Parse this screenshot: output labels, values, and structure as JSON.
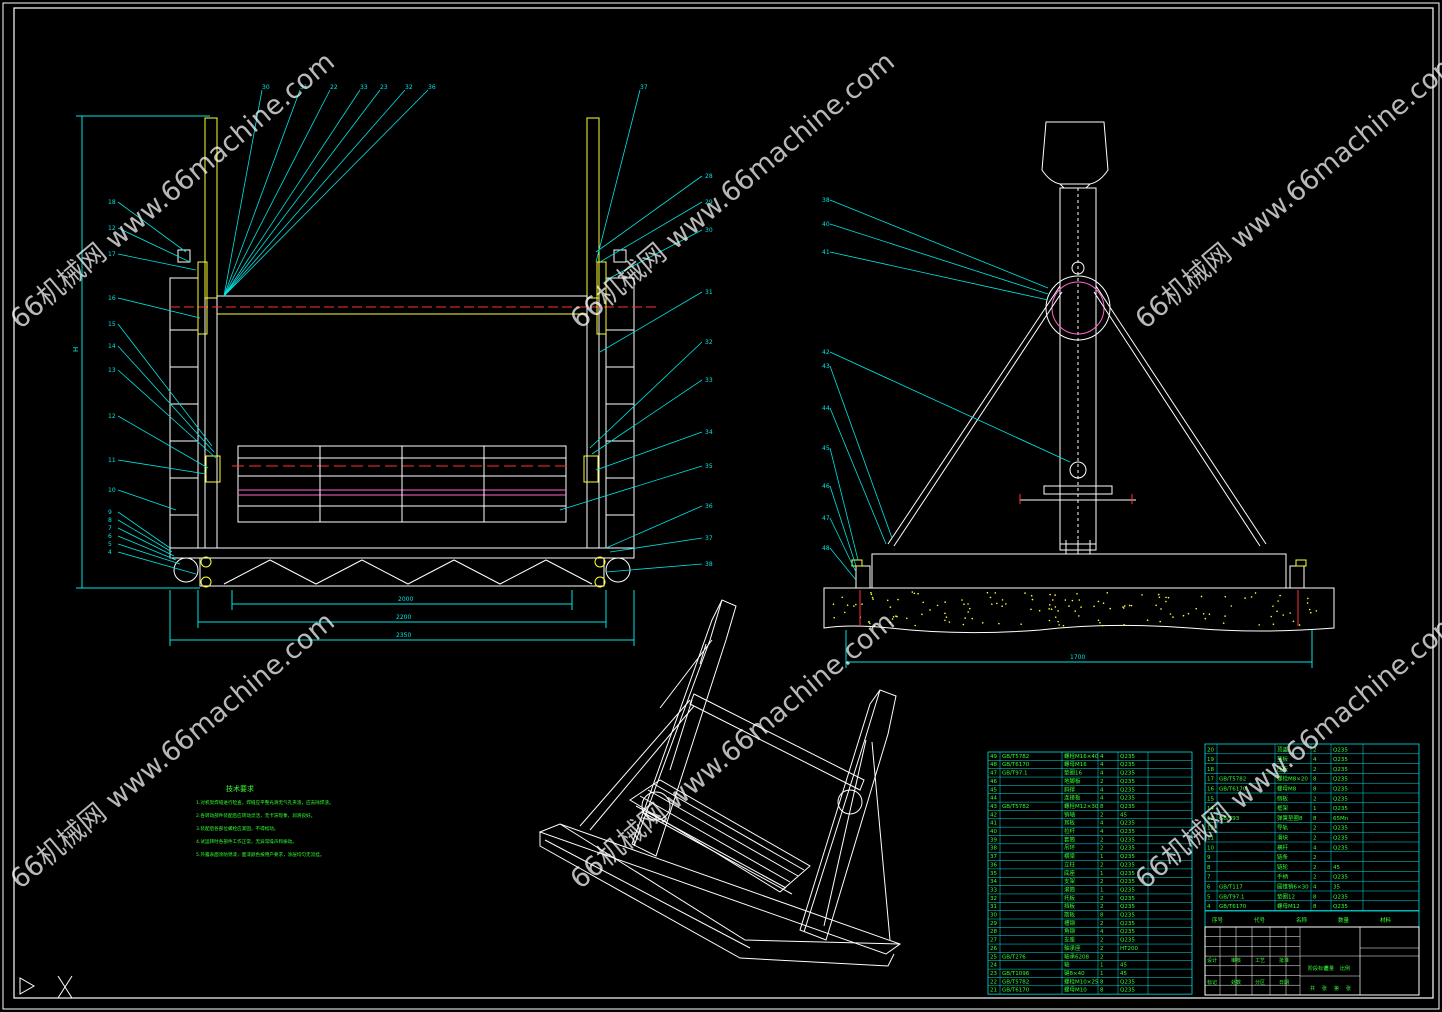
{
  "watermark": {
    "text": "66机械网 www.66machine.com",
    "color": "#ffffff"
  },
  "colors": {
    "background": "#000000",
    "frame": "#ffffff",
    "leader": "#00e5e5",
    "yellow": "#ffff33",
    "green": "#33ff33",
    "red": "#ff3333",
    "magenta": "#ff66cc",
    "table": "#00e5e5"
  },
  "front_view": {
    "balloons_top": [
      "30",
      "31",
      "22",
      "33",
      "23",
      "32",
      "36",
      "37"
    ],
    "balloons_left": [
      "18",
      "12",
      "17",
      "16",
      "15",
      "14",
      "13",
      "12",
      "11",
      "10",
      "9",
      "8",
      "7",
      "6",
      "5",
      "4"
    ],
    "balloons_right": [
      "28",
      "29",
      "30",
      "31",
      "32",
      "33",
      "34",
      "35",
      "36",
      "37",
      "38"
    ],
    "dim_height": "H",
    "dim_inner": "2000",
    "dim_mid": "2200",
    "dim_total": "2350"
  },
  "side_view": {
    "balloons": [
      "38",
      "40",
      "41",
      "42",
      "43",
      "44",
      "45",
      "46",
      "47",
      "48"
    ],
    "dim_base": "1700"
  },
  "tech_notes": {
    "title": "技术要求",
    "lines": [
      "1.对机架焊缝进行检查，焊缝应平整光滑无气孔夹渣，应去除焊渣。",
      "2.各转动部件装配后应转动灵活，无卡滞现象，润滑良好。",
      "3.装配后各部位螺栓应紧固，不得松动。",
      "4.试运转时各部件工作正常，无异常噪声和振动。",
      "5.外露表面涂防锈漆，面漆颜色按用户要求，涂层均匀无流挂。"
    ]
  },
  "bom": {
    "rows_left": [
      [
        "49",
        "GB/T5782",
        "螺栓M16×40",
        "4",
        "Q235"
      ],
      [
        "48",
        "GB/T6170",
        "螺母M16",
        "4",
        "Q235"
      ],
      [
        "47",
        "GB/T97.1",
        "垫圈16",
        "4",
        "Q235"
      ],
      [
        "46",
        "",
        "地脚板",
        "2",
        "Q235"
      ],
      [
        "45",
        "",
        "斜撑",
        "4",
        "Q235"
      ],
      [
        "44",
        "",
        "连接板",
        "4",
        "Q235"
      ],
      [
        "43",
        "GB/T5782",
        "螺栓M12×30",
        "8",
        "Q235"
      ],
      [
        "42",
        "",
        "销轴",
        "2",
        "45"
      ],
      [
        "41",
        "",
        "耳板",
        "4",
        "Q235"
      ],
      [
        "40",
        "",
        "拉杆",
        "4",
        "Q235"
      ],
      [
        "39",
        "",
        "套筒",
        "2",
        "Q235"
      ],
      [
        "38",
        "",
        "吊环",
        "2",
        "Q235"
      ],
      [
        "37",
        "",
        "横梁",
        "1",
        "Q235"
      ],
      [
        "36",
        "",
        "立柱",
        "2",
        "Q235"
      ],
      [
        "35",
        "",
        "底座",
        "1",
        "Q235"
      ],
      [
        "34",
        "",
        "支架",
        "2",
        "Q235"
      ],
      [
        "33",
        "",
        "滚筒",
        "1",
        "Q235"
      ],
      [
        "32",
        "",
        "托板",
        "2",
        "Q235"
      ],
      [
        "31",
        "",
        "挡板",
        "2",
        "Q235"
      ],
      [
        "30",
        "",
        "筋板",
        "8",
        "Q235"
      ],
      [
        "29",
        "",
        "槽钢",
        "2",
        "Q235"
      ],
      [
        "28",
        "",
        "角钢",
        "4",
        "Q235"
      ],
      [
        "27",
        "",
        "支座",
        "2",
        "Q235"
      ],
      [
        "26",
        "",
        "轴承座",
        "2",
        "HT200"
      ],
      [
        "25",
        "GB/T276",
        "轴承6208",
        "2",
        ""
      ],
      [
        "24",
        "",
        "轴",
        "1",
        "45"
      ],
      [
        "23",
        "GB/T1096",
        "键8×40",
        "1",
        "45"
      ],
      [
        "22",
        "GB/T5782",
        "螺栓M10×25",
        "8",
        "Q235"
      ],
      [
        "21",
        "GB/T6170",
        "螺母M10",
        "8",
        "Q235"
      ]
    ],
    "rows_right": [
      [
        "20",
        "",
        "顶盖",
        "2",
        "Q235"
      ],
      [
        "19",
        "",
        "垫板",
        "4",
        "Q235"
      ],
      [
        "18",
        "",
        "压板",
        "2",
        "Q235"
      ],
      [
        "17",
        "GB/T5782",
        "螺栓M8×20",
        "8",
        "Q235"
      ],
      [
        "16",
        "GB/T6170",
        "螺母M8",
        "8",
        "Q235"
      ],
      [
        "15",
        "",
        "侧板",
        "2",
        "Q235"
      ],
      [
        "14",
        "",
        "框架",
        "1",
        "Q235"
      ],
      [
        "13",
        "GB/T93",
        "弹簧垫圈8",
        "8",
        "65Mn"
      ],
      [
        "12",
        "",
        "导轨",
        "2",
        "Q235"
      ],
      [
        "11",
        "",
        "滑块",
        "2",
        "Q235"
      ],
      [
        "10",
        "",
        "横杆",
        "4",
        "Q235"
      ],
      [
        "9",
        "",
        "链条",
        "2",
        ""
      ],
      [
        "8",
        "",
        "链轮",
        "2",
        "45"
      ],
      [
        "7",
        "",
        "手柄",
        "2",
        "Q235"
      ],
      [
        "6",
        "GB/T117",
        "圆锥销6×30",
        "4",
        "35"
      ],
      [
        "5",
        "GB/T97.1",
        "垫圈12",
        "8",
        "Q235"
      ],
      [
        "4",
        "GB/T6170",
        "螺母M12",
        "8",
        "Q235"
      ]
    ],
    "header": [
      "序号",
      "代号",
      "名称",
      "数量",
      "材料"
    ]
  },
  "title_block": {
    "labels": [
      "设计",
      "审核",
      "工艺",
      "批准",
      "标记",
      "处数",
      "分区",
      "日期"
    ],
    "right_labels": [
      "阶段标记",
      "重量",
      "比例"
    ],
    "sheet": [
      "共",
      "张",
      "第",
      "张"
    ]
  }
}
